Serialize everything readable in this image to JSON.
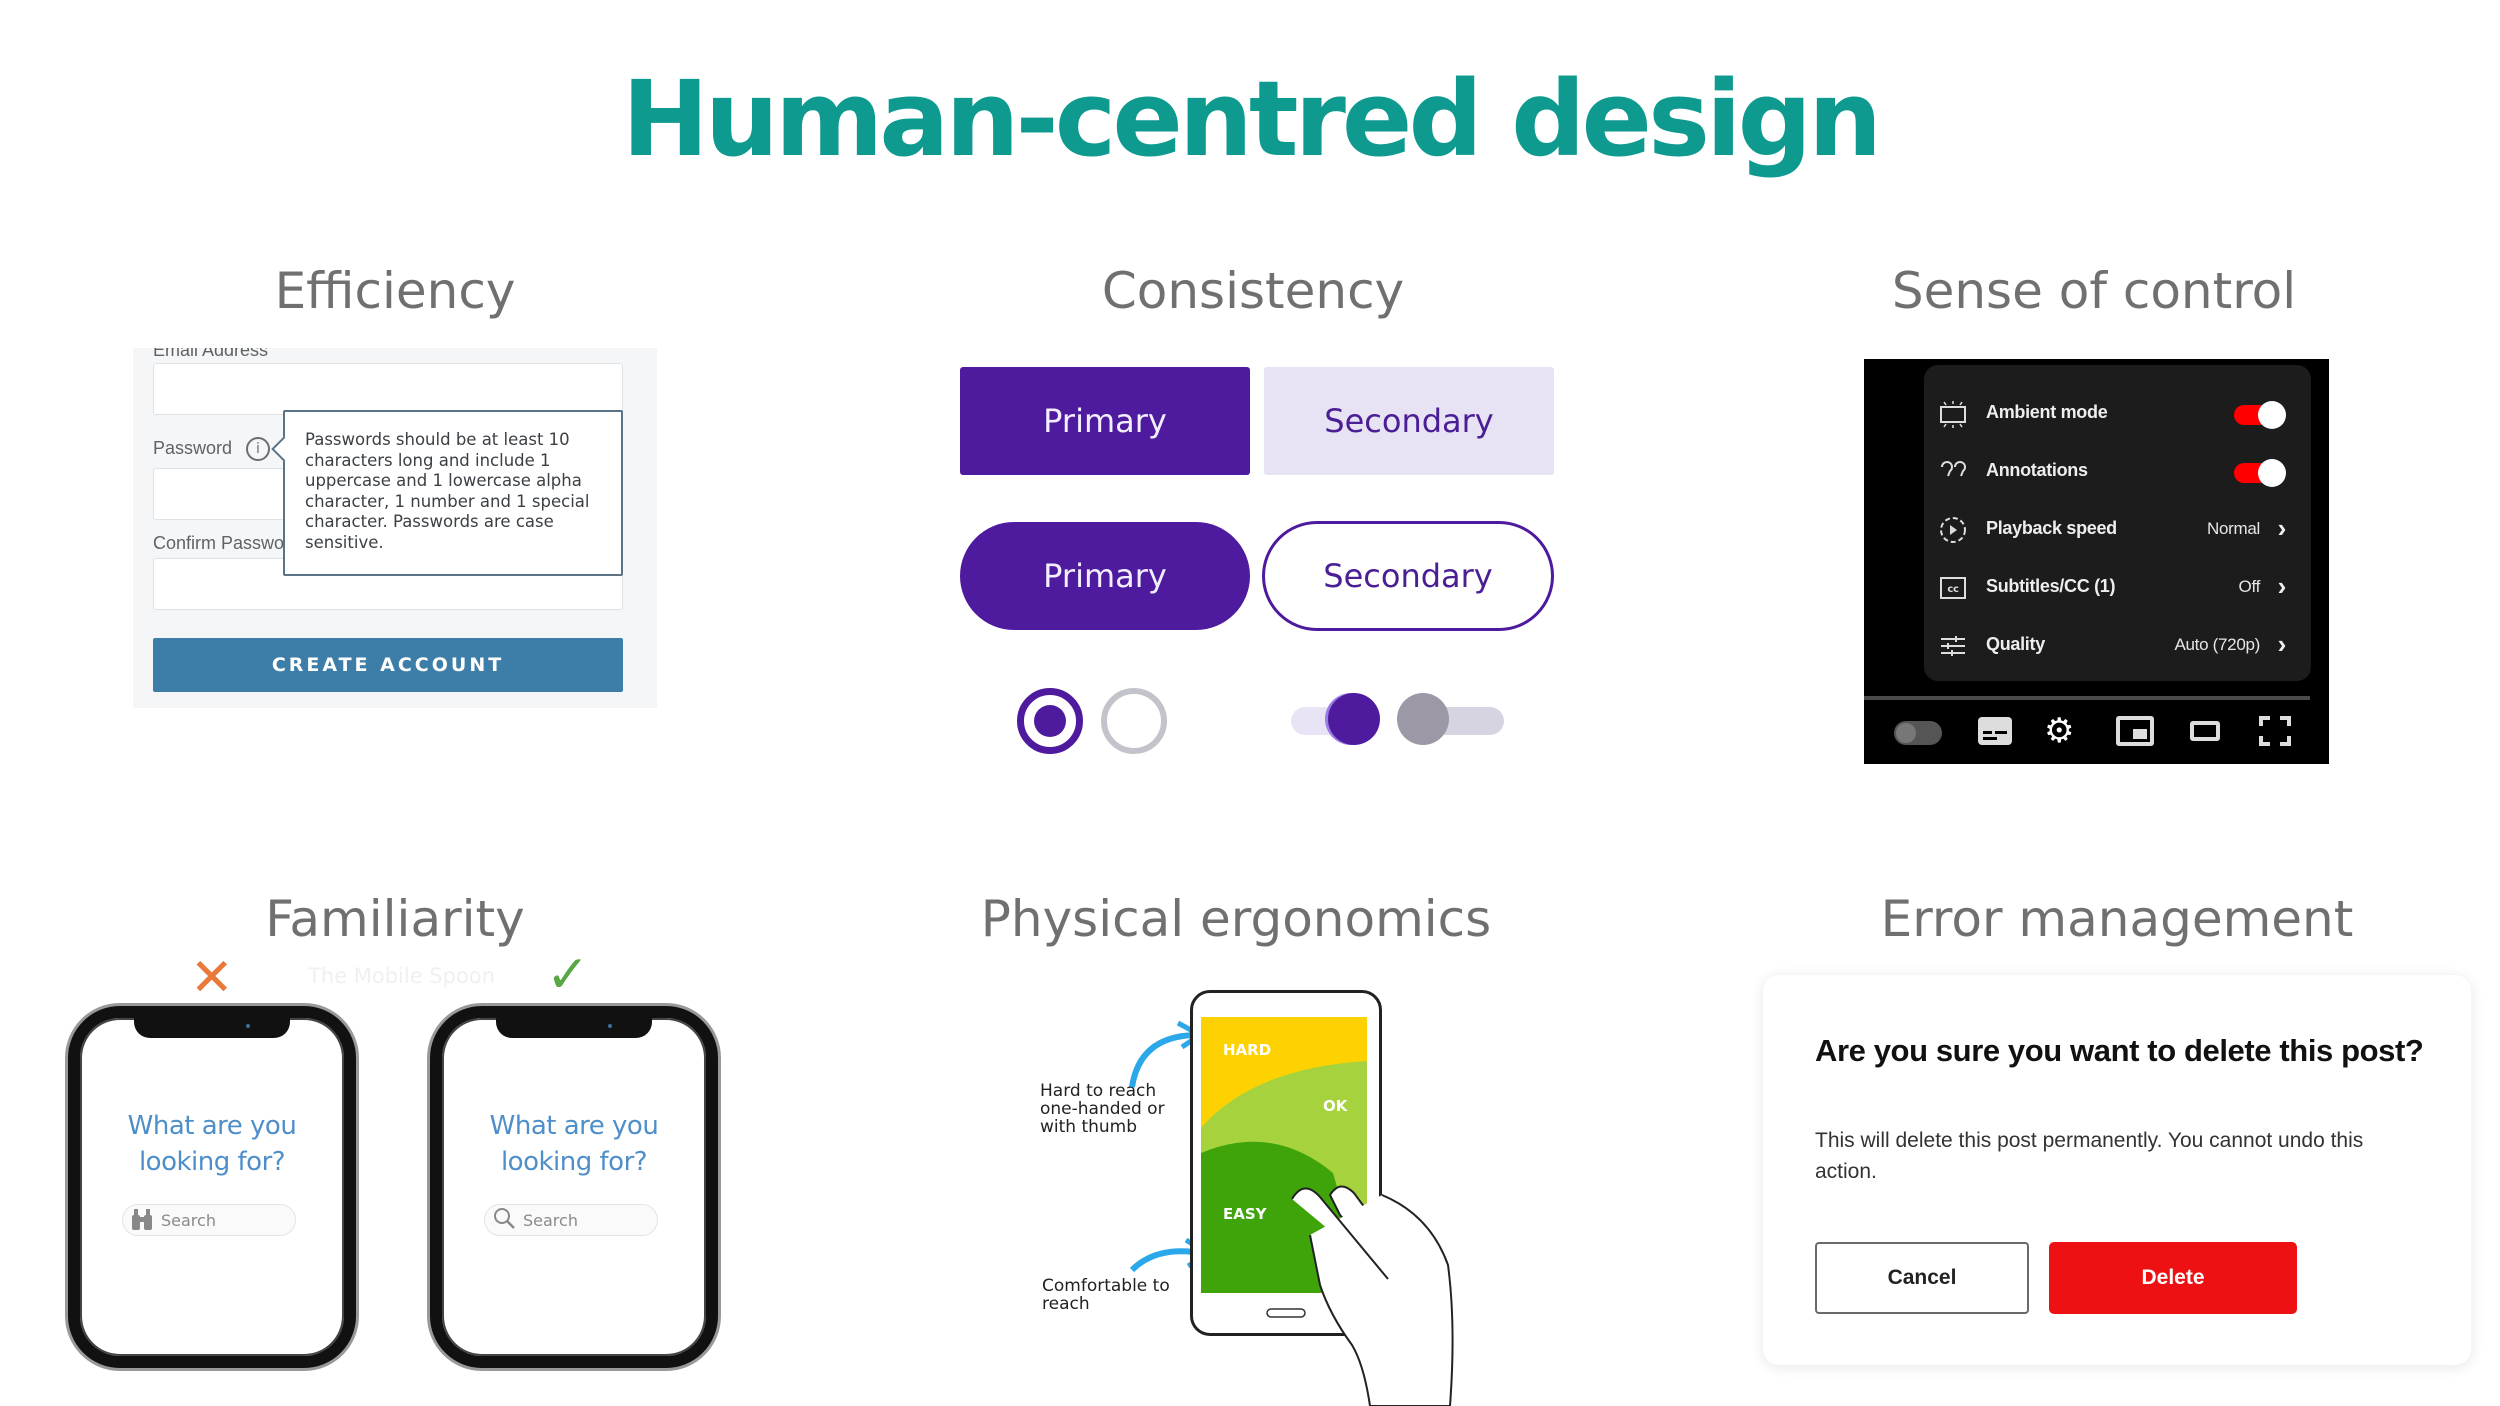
{
  "page": {
    "title": "Human-centred design",
    "title_color": "#0e9a8f"
  },
  "sections": {
    "efficiency": {
      "heading": "Efficiency",
      "email_label": "Email Address",
      "password_label": "Password",
      "info_icon": "info-cursor-icon",
      "confirm_label": "Confirm Password",
      "tooltip": "Passwords should be at least 10 characters long and include 1 uppercase and 1 lowercase alpha character, 1 number and 1 special character. Passwords are case sensitive.",
      "create_button": "CREATE ACCOUNT",
      "button_color": "#3d7ea8"
    },
    "consistency": {
      "heading": "Consistency",
      "primary_rect": "Primary",
      "secondary_rect": "Secondary",
      "primary_pill": "Primary",
      "secondary_pill": "Secondary",
      "radio_selected": true,
      "radio_unselected": false,
      "toggle_on": true,
      "toggle_off": false,
      "accent_color": "#4f1b9e"
    },
    "sense_of_control": {
      "heading": "Sense of control",
      "menu": [
        {
          "icon": "ambient-mode-icon",
          "label": "Ambient mode",
          "type": "switch",
          "on": true
        },
        {
          "icon": "annotations-icon",
          "label": "Annotations",
          "type": "switch",
          "on": true
        },
        {
          "icon": "playback-speed-icon",
          "label": "Playback speed",
          "value": "Normal",
          "type": "submenu"
        },
        {
          "icon": "subtitles-icon",
          "label": "Subtitles/CC (1)",
          "value": "Off",
          "type": "submenu"
        },
        {
          "icon": "quality-icon",
          "label": "Quality",
          "value": "Auto (720p)",
          "type": "submenu"
        }
      ],
      "controls": [
        "autoplay-toggle-icon",
        "subtitles-button-icon",
        "settings-gear-icon",
        "miniplayer-icon",
        "theater-mode-icon",
        "fullscreen-icon"
      ],
      "switch_color": "#ff0000"
    },
    "familiarity": {
      "heading": "Familiarity",
      "watermark": "The Mobile Spoon",
      "bad_mark": "✕",
      "good_mark": "✓",
      "bad_color": "#e8793a",
      "good_color": "#5aa845",
      "question": "What are you looking for?",
      "search_placeholder": "Search",
      "bad_search_icon": "binoculars-icon",
      "good_search_icon": "magnifier-icon"
    },
    "physical_ergonomics": {
      "heading": "Physical ergonomics",
      "hard_note": "Hard to reach one-handed or with thumb",
      "comfortable_note": "Comfortable to reach",
      "zones": [
        {
          "label": "HARD",
          "color": "#fdd200"
        },
        {
          "label": "OK",
          "color": "#a6d23e"
        },
        {
          "label": "EASY",
          "color": "#3ea40a"
        }
      ]
    },
    "error_management": {
      "heading": "Error management",
      "dialog_title": "Are you sure you want to delete this post?",
      "dialog_body": "This will delete this post permanently. You cannot undo this action.",
      "cancel_label": "Cancel",
      "delete_label": "Delete",
      "delete_color": "#ee1113"
    }
  }
}
